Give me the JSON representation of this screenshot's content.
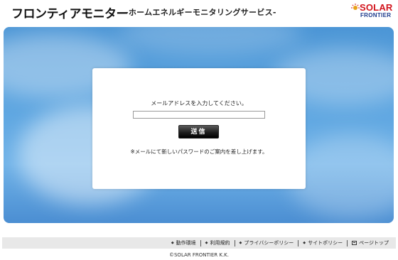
{
  "header": {
    "title": "フロンティアモニター",
    "subtitle": "-ホームエネルギーモニタリングサービス-",
    "logo": {
      "line1": "SOLAR",
      "line2": "FRONTIER",
      "color_primary": "#d2141c",
      "color_secondary": "#1b3a8c"
    }
  },
  "form": {
    "prompt": "メールアドレスを入力してください。",
    "email_value": "",
    "submit_label": "送信",
    "note": "※メールにて新しいパスワードのご案内を差し上げます。"
  },
  "footer": {
    "links": [
      {
        "label": "動作環境",
        "icon": "bullet-icon"
      },
      {
        "label": "利用規約",
        "icon": "bullet-icon"
      },
      {
        "label": "プライバシーポリシー",
        "icon": "bullet-icon"
      },
      {
        "label": "サイトポリシー",
        "icon": "bullet-icon"
      },
      {
        "label": "ページトップ",
        "icon": "page-top-icon"
      }
    ],
    "copyright": "©SOLAR FRONTIER K.K."
  },
  "colors": {
    "sky": "#5aa3df",
    "footer_bar": "#e8e8e8",
    "button": "#1e1e1e"
  }
}
